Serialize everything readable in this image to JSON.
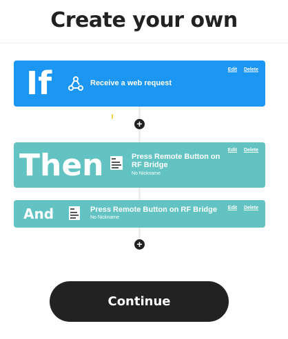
{
  "header": {
    "title": "Create your own"
  },
  "trigger": {
    "keyword": "If",
    "service_icon": "webhooks-icon",
    "text": "Receive a web request",
    "edit_label": "Edit",
    "delete_label": "Delete"
  },
  "actions": [
    {
      "keyword": "Then",
      "service_icon": "rf-bridge-thumbnail",
      "text": "Press Remote Button on RF Bridge",
      "nickname": "No Nickname",
      "edit_label": "Edit",
      "delete_label": "Delete"
    },
    {
      "keyword": "And",
      "service_icon": "rf-bridge-thumbnail",
      "text": "Press Remote Button on RF Bridge",
      "nickname": "No Nickname",
      "edit_label": "Edit",
      "delete_label": "Delete"
    }
  ],
  "add_label": "+",
  "continue_label": "Continue",
  "colors": {
    "trigger": "#1b96f3",
    "action": "#62c3c2",
    "button": "#222222"
  }
}
